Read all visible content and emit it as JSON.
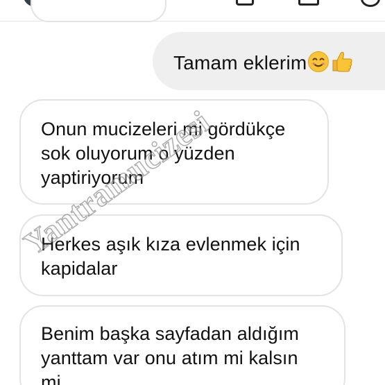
{
  "header": {
    "avatar": "avatar",
    "icons": [
      "video-call-icon",
      "chat-icon",
      "info-icon"
    ]
  },
  "messages": [
    {
      "direction": "outgoing",
      "text": "Tamam eklerim",
      "emojis": [
        "smiling-face-icon",
        "thumbs-up-icon"
      ]
    },
    {
      "direction": "incoming",
      "text": "Onun mucizeleri mi gördükçe\nsok oluyorum o yüzden\nyaptiriyorum"
    },
    {
      "direction": "incoming",
      "text": "Herkes aşık kıza evlenmek için\nkapidalar"
    },
    {
      "direction": "incoming",
      "text": "Benim başka sayfadan aldığım\nyanttam var onu atım mi kalsın\nmi"
    }
  ],
  "watermark": "Yantramucizesi",
  "colors": {
    "outgoing_bubble": "#efefef",
    "incoming_border": "#e3e3e3",
    "text": "#111111"
  }
}
